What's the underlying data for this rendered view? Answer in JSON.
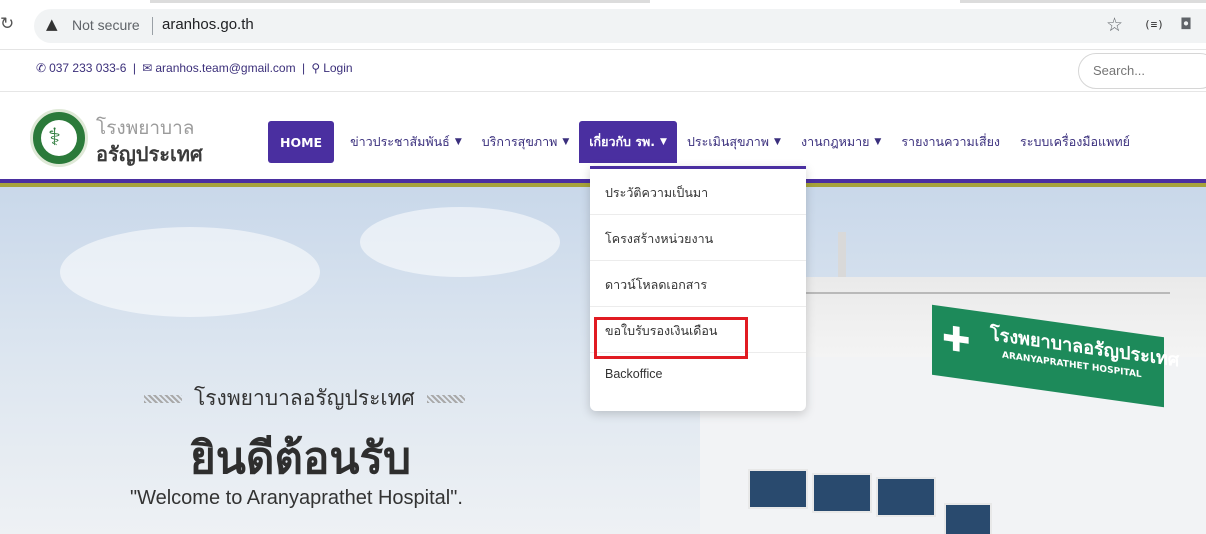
{
  "browser": {
    "security_label": "Not secure",
    "url": "aranhos.go.th"
  },
  "topbar": {
    "phone": "037 233 033-6",
    "email": "aranhos.team@gmail.com",
    "login": "Login",
    "search_placeholder": "Search..."
  },
  "brand": {
    "line1": "โรงพยาบาล",
    "line2": "อรัญประเทศ"
  },
  "nav": {
    "items": [
      {
        "label": "HOME"
      },
      {
        "label": "ข่าวประชาสัมพันธ์"
      },
      {
        "label": "บริการสุขภาพ"
      },
      {
        "label": "เกี่ยวกับ รพ."
      },
      {
        "label": "ประเมินสุขภาพ"
      },
      {
        "label": "งานกฎหมาย"
      },
      {
        "label": "รายงานความเสี่ยง"
      },
      {
        "label": "ระบบเครื่องมือแพทย์"
      }
    ]
  },
  "dropdown": {
    "items": [
      {
        "label": "ประวัติความเป็นมา"
      },
      {
        "label": "โครงสร้างหน่วยงาน"
      },
      {
        "label": "ดาวน์โหลดเอกสาร"
      },
      {
        "label": "ขอใบรับรองเงินเดือน"
      },
      {
        "label": "Backoffice"
      }
    ]
  },
  "hero": {
    "subtitle": "โรงพยาบาลอรัญประเทศ",
    "title": "ยินดีต้อนรับ",
    "english": "\"Welcome to Aranyaprathet Hospital\"."
  },
  "sign": {
    "thai": "โรงพยาบาลอรัญประเทศ",
    "english": "ARANYAPRATHET HOSPITAL"
  },
  "colors": {
    "primary": "#4a2fa0",
    "accent_olive": "#a6a33a",
    "highlight_red": "#e11b22",
    "sign_green": "#1d8a5a"
  }
}
